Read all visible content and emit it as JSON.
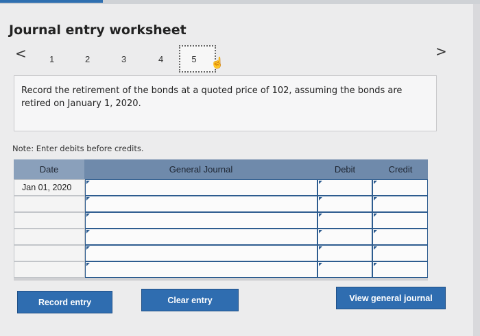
{
  "page": {
    "title": "Journal entry worksheet"
  },
  "nav": {
    "prev_icon": "chevron-left-icon",
    "next_icon": "chevron-right-icon",
    "prev_glyph": "<",
    "next_glyph": ">",
    "steps": [
      "1",
      "2",
      "3",
      "4",
      "5"
    ],
    "active_step": "5"
  },
  "prompt": {
    "text": "Record the retirement of the bonds at a quoted price of 102, assuming the bonds are retired on January 1, 2020."
  },
  "note": {
    "text": "Note: Enter debits before credits."
  },
  "table": {
    "headers": {
      "date": "Date",
      "general_journal": "General Journal",
      "debit": "Debit",
      "credit": "Credit"
    },
    "rows": [
      {
        "date": "Jan 01, 2020",
        "account": "",
        "debit": "",
        "credit": ""
      },
      {
        "date": "",
        "account": "",
        "debit": "",
        "credit": ""
      },
      {
        "date": "",
        "account": "",
        "debit": "",
        "credit": ""
      },
      {
        "date": "",
        "account": "",
        "debit": "",
        "credit": ""
      },
      {
        "date": "",
        "account": "",
        "debit": "",
        "credit": ""
      },
      {
        "date": "",
        "account": "",
        "debit": "",
        "credit": ""
      }
    ]
  },
  "buttons": {
    "record": "Record entry",
    "clear": "Clear entry",
    "view": "View general journal"
  },
  "colors": {
    "button_blue": "#2f6db0",
    "header_blue": "#6f8aab",
    "cell_border": "#2d5c8f"
  }
}
